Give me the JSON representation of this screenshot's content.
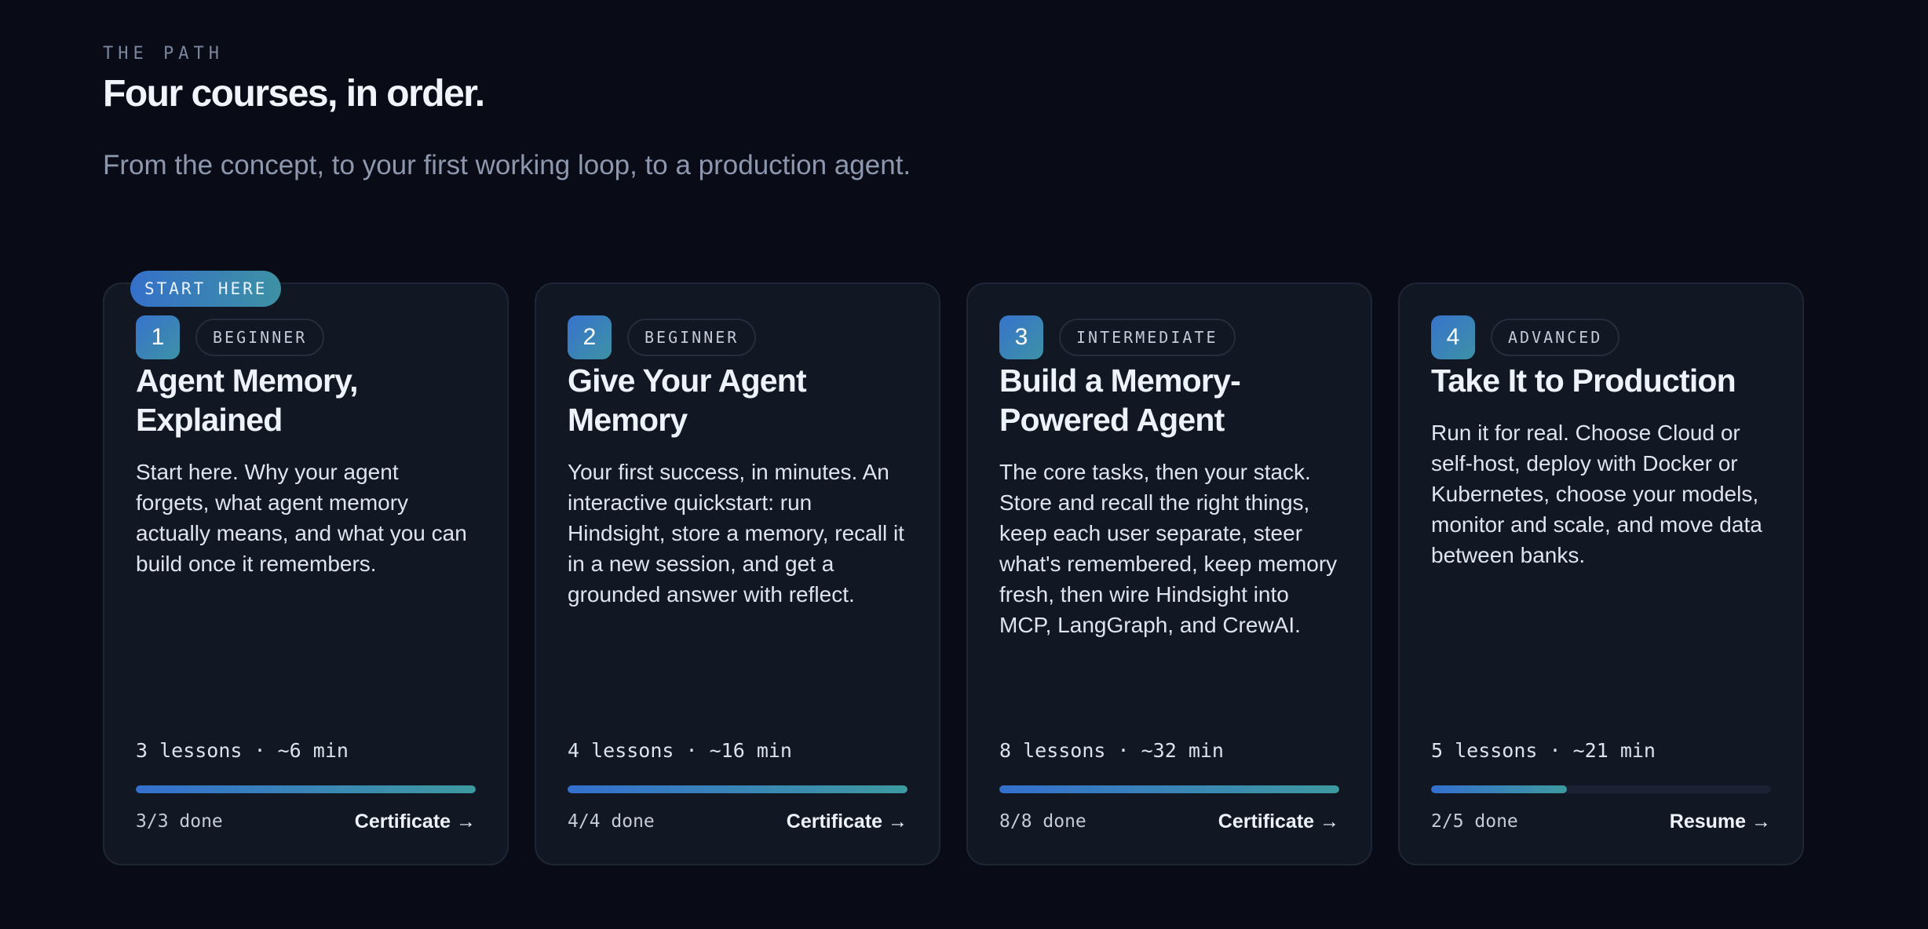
{
  "section": {
    "eyebrow": "THE PATH",
    "title": "Four courses, in order.",
    "subtitle": "From the concept, to your first working loop, to a production agent."
  },
  "colors": {
    "background": "#090c16",
    "card": "#111723",
    "accent_start": "#3470cf",
    "accent_end": "#3d9a9f"
  },
  "courses": [
    {
      "badge": "START HERE",
      "number": "1",
      "level": "BEGINNER",
      "title": "Agent Memory, Explained",
      "description": "Start here. Why your agent forgets, what agent memory actually means, and what you can build once it remembers.",
      "lessons": "3 lessons · ~6 min",
      "progress": 1.0,
      "done": "3/3 done",
      "action": "Certificate →"
    },
    {
      "number": "2",
      "level": "BEGINNER",
      "title": "Give Your Agent Memory",
      "description": "Your first success, in minutes. An interactive quickstart: run Hindsight, store a memory, recall it in a new session, and get a grounded answer with reflect.",
      "lessons": "4 lessons · ~16 min",
      "progress": 1.0,
      "done": "4/4 done",
      "action": "Certificate →"
    },
    {
      "number": "3",
      "level": "INTERMEDIATE",
      "title": "Build a Memory-Powered Agent",
      "description": "The core tasks, then your stack. Store and recall the right things, keep each user separate, steer what's remembered, keep memory fresh, then wire Hindsight into MCP, LangGraph, and CrewAI.",
      "lessons": "8 lessons · ~32 min",
      "progress": 1.0,
      "done": "8/8 done",
      "action": "Certificate →"
    },
    {
      "number": "4",
      "level": "ADVANCED",
      "title": "Take It to Production",
      "description": "Run it for real. Choose Cloud or self-host, deploy with Docker or Kubernetes, choose your models, monitor and scale, and move data between banks.",
      "lessons": "5 lessons · ~21 min",
      "progress": 0.4,
      "done": "2/5 done",
      "action": "Resume →"
    }
  ]
}
